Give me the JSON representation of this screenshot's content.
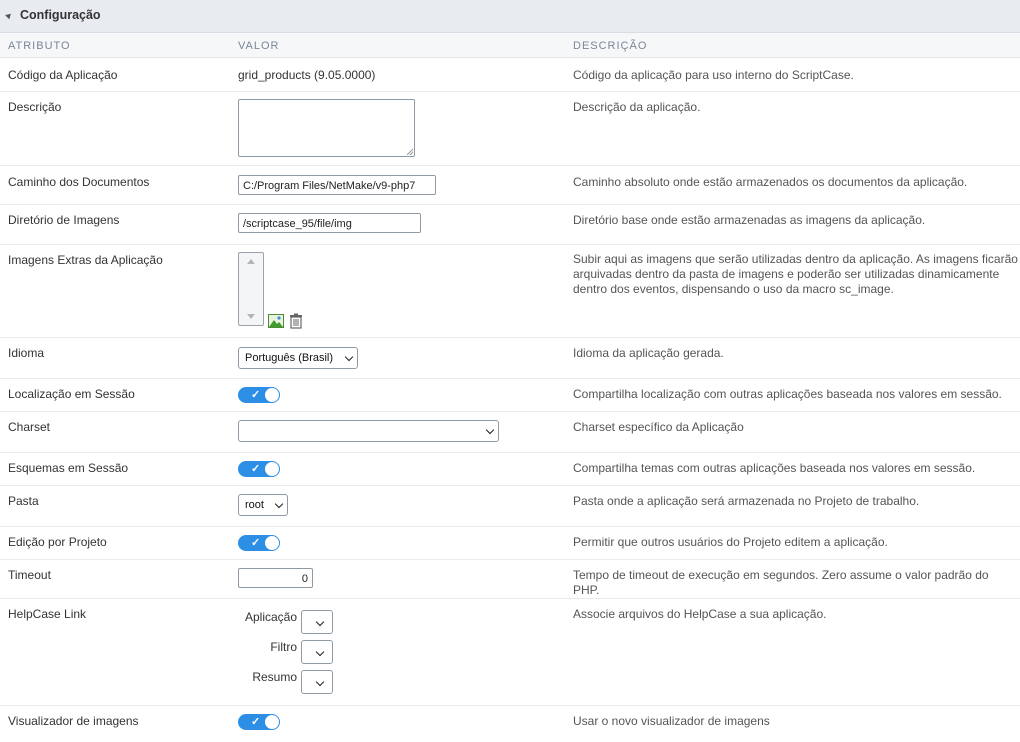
{
  "section": {
    "title": "Configuração"
  },
  "columns": {
    "attribute": "ATRIBUTO",
    "value": "VALOR",
    "description": "DESCRIÇÃO"
  },
  "rows": {
    "codigo": {
      "label": "Código da Aplicação",
      "value": "grid_products (9.05.0000)",
      "desc": "Código da aplicação para uso interno do ScriptCase."
    },
    "descricao": {
      "label": "Descrição",
      "value": "",
      "desc": "Descrição da aplicação."
    },
    "caminho": {
      "label": "Caminho dos Documentos",
      "value": "C:/Program Files/NetMake/v9-php7",
      "desc": "Caminho absoluto onde estão armazenados os documentos da aplicação."
    },
    "diretorio": {
      "label": "Diretório de Imagens",
      "value": "/scriptcase_95/file/img",
      "desc": "Diretório base onde estão armazenadas as imagens da aplicação."
    },
    "imagens": {
      "label": "Imagens Extras da Aplicação",
      "desc_lines": [
        "Subir aqui as imagens que serão utilizadas dentro da aplicação. As imagens ficarão",
        "arquivadas dentro da pasta de imagens e poderão ser utilizadas dinamicamente",
        "dentro dos eventos, dispensando o uso da macro sc_image."
      ]
    },
    "idioma": {
      "label": "Idioma",
      "value": "Português (Brasil)",
      "desc": "Idioma da aplicação gerada."
    },
    "localizacao": {
      "label": "Localização em Sessão",
      "checked": true,
      "desc": "Compartilha localização com outras aplicações baseada nos valores em sessão."
    },
    "charset": {
      "label": "Charset",
      "value": "",
      "desc": "Charset específico da Aplicação"
    },
    "esquemas": {
      "label": "Esquemas em Sessão",
      "checked": true,
      "desc": "Compartilha temas com outras aplicações baseada nos valores em sessão."
    },
    "pasta": {
      "label": "Pasta",
      "value": "root",
      "desc": "Pasta onde a aplicação será armazenada no Projeto de trabalho."
    },
    "edicao": {
      "label": "Edição por Projeto",
      "checked": true,
      "desc": "Permitir que outros usuários do Projeto editem a aplicação."
    },
    "timeout": {
      "label": "Timeout",
      "value": "0",
      "desc": "Tempo de timeout de execução em segundos. Zero assume o valor padrão do PHP."
    },
    "helpcase": {
      "label": "HelpCase Link",
      "sub": {
        "aplicacao": "Aplicação",
        "filtro": "Filtro",
        "resumo": "Resumo"
      },
      "desc": "Associe arquivos do HelpCase a sua aplicação."
    },
    "visualizador": {
      "label": "Visualizador de imagens",
      "checked": true,
      "desc": "Usar o novo visualizador de imagens"
    }
  },
  "icons": {
    "collapse": "collapse-triangle-icon",
    "add_image": "image-add-icon",
    "delete": "trash-icon",
    "toggle_check": "checkmark-icon"
  },
  "colors": {
    "toggle_on": "#2d8ee6",
    "header_bg": "#e8ecf1"
  }
}
